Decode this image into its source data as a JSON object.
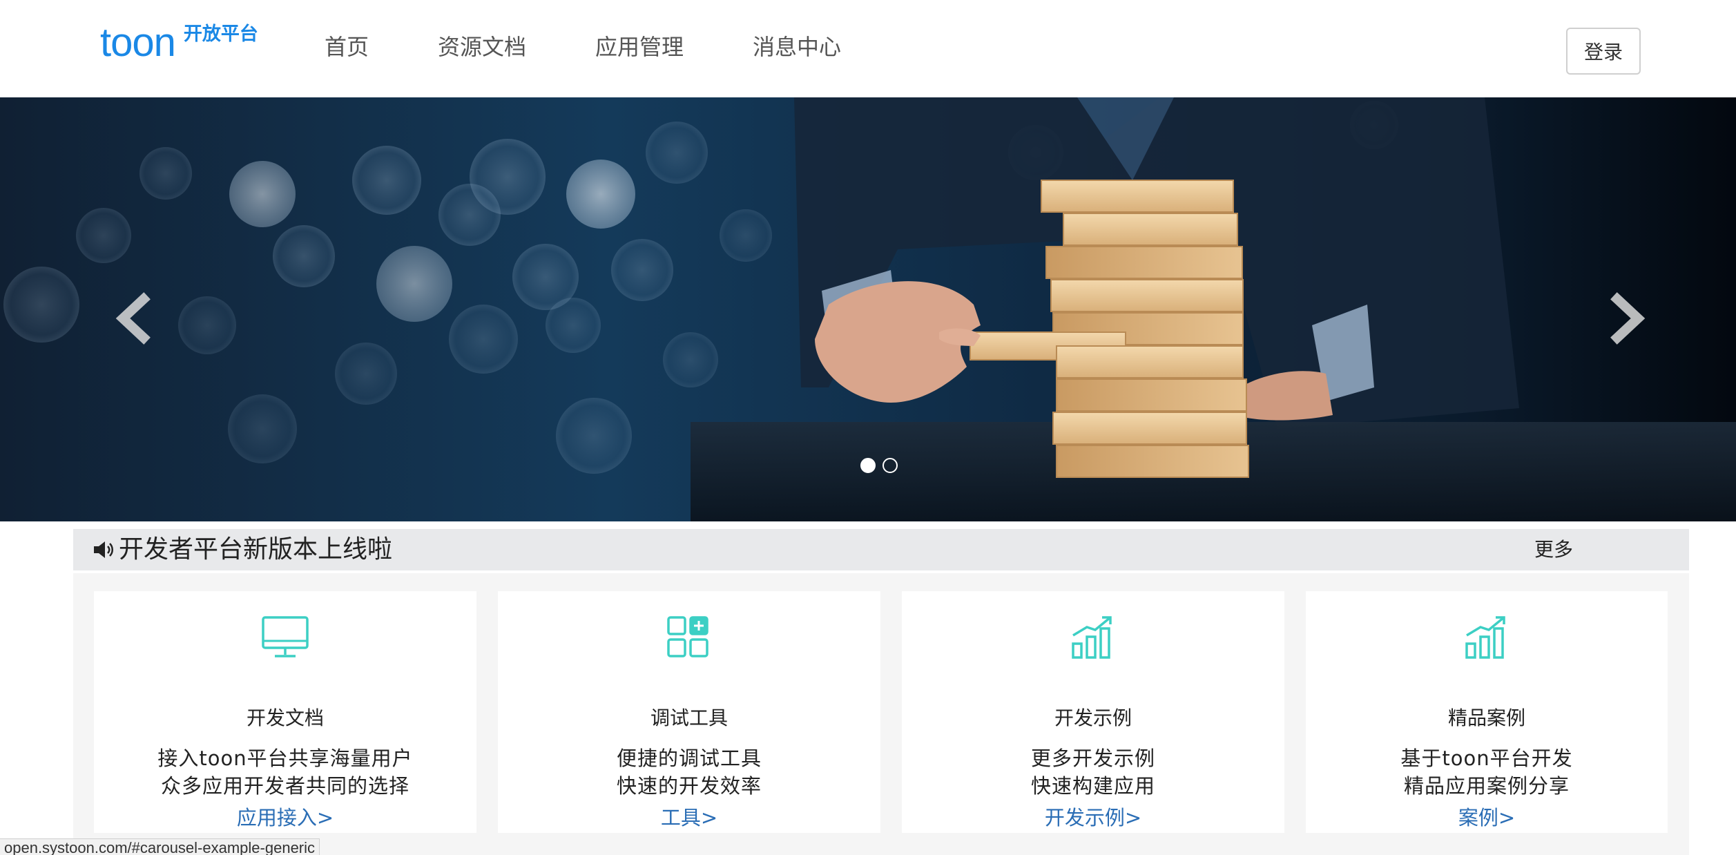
{
  "header": {
    "logo_main": "toon",
    "logo_sub": "开放平台",
    "nav": [
      {
        "label": "首页"
      },
      {
        "label": "资源文档"
      },
      {
        "label": "应用管理"
      },
      {
        "label": "消息中心"
      }
    ],
    "login_label": "登录"
  },
  "carousel": {
    "slide_count": 2,
    "active_index": 0
  },
  "notice": {
    "text": "开发者平台新版本上线啦",
    "more_label": "更多"
  },
  "cards": [
    {
      "title": "开发文档",
      "desc_line1": "接入toon平台共享海量用户",
      "desc_line2": "众多应用开发者共同的选择",
      "link": "应用接入>",
      "icon": "monitor-icon"
    },
    {
      "title": "调试工具",
      "desc_line1": "便捷的调试工具",
      "desc_line2": "快速的开发效率",
      "link": "工具>",
      "icon": "grid-plus-icon"
    },
    {
      "title": "开发示例",
      "desc_line1": "更多开发示例",
      "desc_line2": "快速构建应用",
      "link": "开发示例>",
      "icon": "growth-chart-icon"
    },
    {
      "title": "精品案例",
      "desc_line1": "基于toon平台开发",
      "desc_line2": "精品应用案例分享",
      "link": "案例>",
      "icon": "growth-chart-icon"
    }
  ],
  "status_bar": {
    "url": "open.systoon.com/#carousel-example-generic"
  },
  "colors": {
    "brand": "#1a88e6",
    "link": "#2a6db5",
    "icon_teal": "#3ccfc4"
  }
}
